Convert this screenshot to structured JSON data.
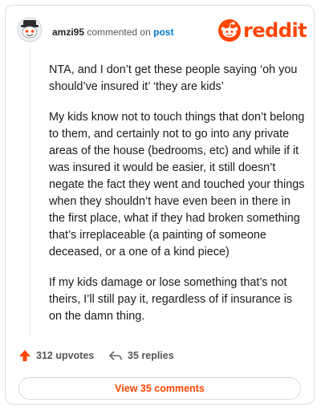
{
  "header": {
    "username": "amzi95",
    "action_text": "commented on",
    "post_link": "post",
    "logo_text": "reddit",
    "logo_icon": "reddit-alien-icon",
    "avatar_icon": "snoo-avatar-icon"
  },
  "comment": {
    "paragraphs": [
      "NTA, and I don’t get these people saying ‘oh you should’ve insured it’ ‘they are kids’",
      "My kids know not to touch things that don’t belong to them, and certainly not to go into any private areas of the house (bedrooms, etc) and while if it was insured it would be easier, it still doesn’t negate the fact they went and touched your things when they shouldn’t have even been in there in the first place, what if they had broken something that’s irreplaceable (a painting of someone deceased, or a one of a kind piece)",
      "If my kids damage or lose something that’s not theirs, I’ll still pay it, regardless of if insurance is on the damn thing."
    ]
  },
  "actions": {
    "upvotes_label": "312 upvotes",
    "replies_label": "35 replies",
    "upvote_icon": "upvote-arrow-icon",
    "reply_icon": "reply-arrow-icon"
  },
  "footer": {
    "view_comments_label": "View 35 comments"
  },
  "colors": {
    "brand": "#ff4500",
    "link": "#0079d3",
    "text": "#1a1a1b",
    "border": "#dcdcdc"
  }
}
